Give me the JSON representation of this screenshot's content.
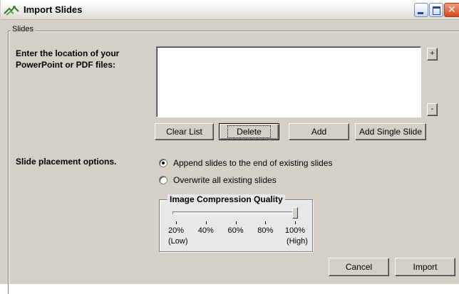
{
  "window": {
    "title": "Import Slides",
    "controls": {
      "minimize": "minimize",
      "maximize": "maximize",
      "close": "close"
    }
  },
  "slides_group": {
    "label": "Slides",
    "location_label": "Enter the location of your PowerPoint or PDF files:",
    "files": [],
    "add_row_label": "+",
    "remove_row_label": "-",
    "buttons": {
      "clear_list": "Clear List",
      "delete": "Delete",
      "add": "Add",
      "add_single_slide": "Add Single Slide"
    }
  },
  "placement": {
    "label": "Slide placement options.",
    "options": [
      {
        "label": "Append slides to the end of existing slides",
        "selected": true
      },
      {
        "label": "Overwrite all existing slides",
        "selected": false
      }
    ]
  },
  "compression": {
    "title": "Image Compression Quality",
    "value_percent": 100,
    "ticks": [
      "20%",
      "40%",
      "60%",
      "80%",
      "100%"
    ],
    "min_caption": "(Low)",
    "max_caption": "(High)"
  },
  "footer": {
    "cancel": "Cancel",
    "import": "Import"
  },
  "colors": {
    "face": "#d4d0c8",
    "title_gradient_top": "#ffffff",
    "close_red": "#d4461f"
  }
}
